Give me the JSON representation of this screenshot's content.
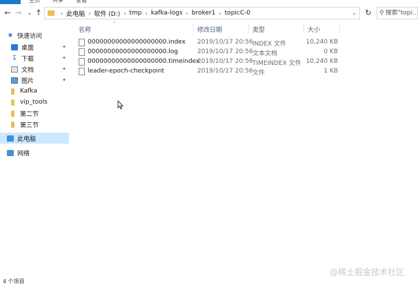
{
  "ribbon": {
    "tabs": [
      "文件",
      "主页",
      "共享",
      "查看"
    ]
  },
  "nav": {
    "back_icon": "arrow-left-icon",
    "forward_icon": "arrow-right-icon",
    "recent_icon": "chevron-down-icon",
    "up_icon": "arrow-up-icon"
  },
  "breadcrumb": [
    "此电脑",
    "软件 (D:)",
    "tmp",
    "kafka-logs",
    "broker1",
    "topicC-0"
  ],
  "search": {
    "placeholder": "搜索\"topi..."
  },
  "sidebar": {
    "items": [
      {
        "label": "快速访问",
        "icon": "star-icon",
        "pinned": false
      },
      {
        "label": "桌面",
        "icon": "desktop-icon",
        "pinned": true
      },
      {
        "label": "下载",
        "icon": "download-icon",
        "pinned": true
      },
      {
        "label": "文档",
        "icon": "documents-icon",
        "pinned": true
      },
      {
        "label": "图片",
        "icon": "pictures-icon",
        "pinned": true
      },
      {
        "label": "Kafka",
        "icon": "folder-icon",
        "pinned": false
      },
      {
        "label": "vip_tools",
        "icon": "folder-icon",
        "pinned": false
      },
      {
        "label": "第二节",
        "icon": "folder-icon",
        "pinned": false
      },
      {
        "label": "第三节",
        "icon": "folder-icon",
        "pinned": false
      },
      {
        "label": "此电脑",
        "icon": "computer-icon",
        "pinned": false,
        "selected": true
      },
      {
        "label": "网络",
        "icon": "network-icon",
        "pinned": false
      }
    ]
  },
  "columns": {
    "name": "名称",
    "date": "修改日期",
    "type": "类型",
    "size": "大小"
  },
  "files": [
    {
      "name": "00000000000000000000.index",
      "date": "2019/10/17 20:56",
      "type": "INDEX 文件",
      "size": "10,240 KB"
    },
    {
      "name": "00000000000000000000.log",
      "date": "2019/10/17 20:56",
      "type": "文本文档",
      "size": "0 KB"
    },
    {
      "name": "00000000000000000000.timeindex",
      "date": "2019/10/17 20:56",
      "type": "TIMEINDEX 文件",
      "size": "10,240 KB"
    },
    {
      "name": "leader-epoch-checkpoint",
      "date": "2019/10/17 20:56",
      "type": "文件",
      "size": "1 KB"
    }
  ],
  "status": {
    "count": "4 个项目"
  },
  "watermark": "@稀土掘金技术社区"
}
